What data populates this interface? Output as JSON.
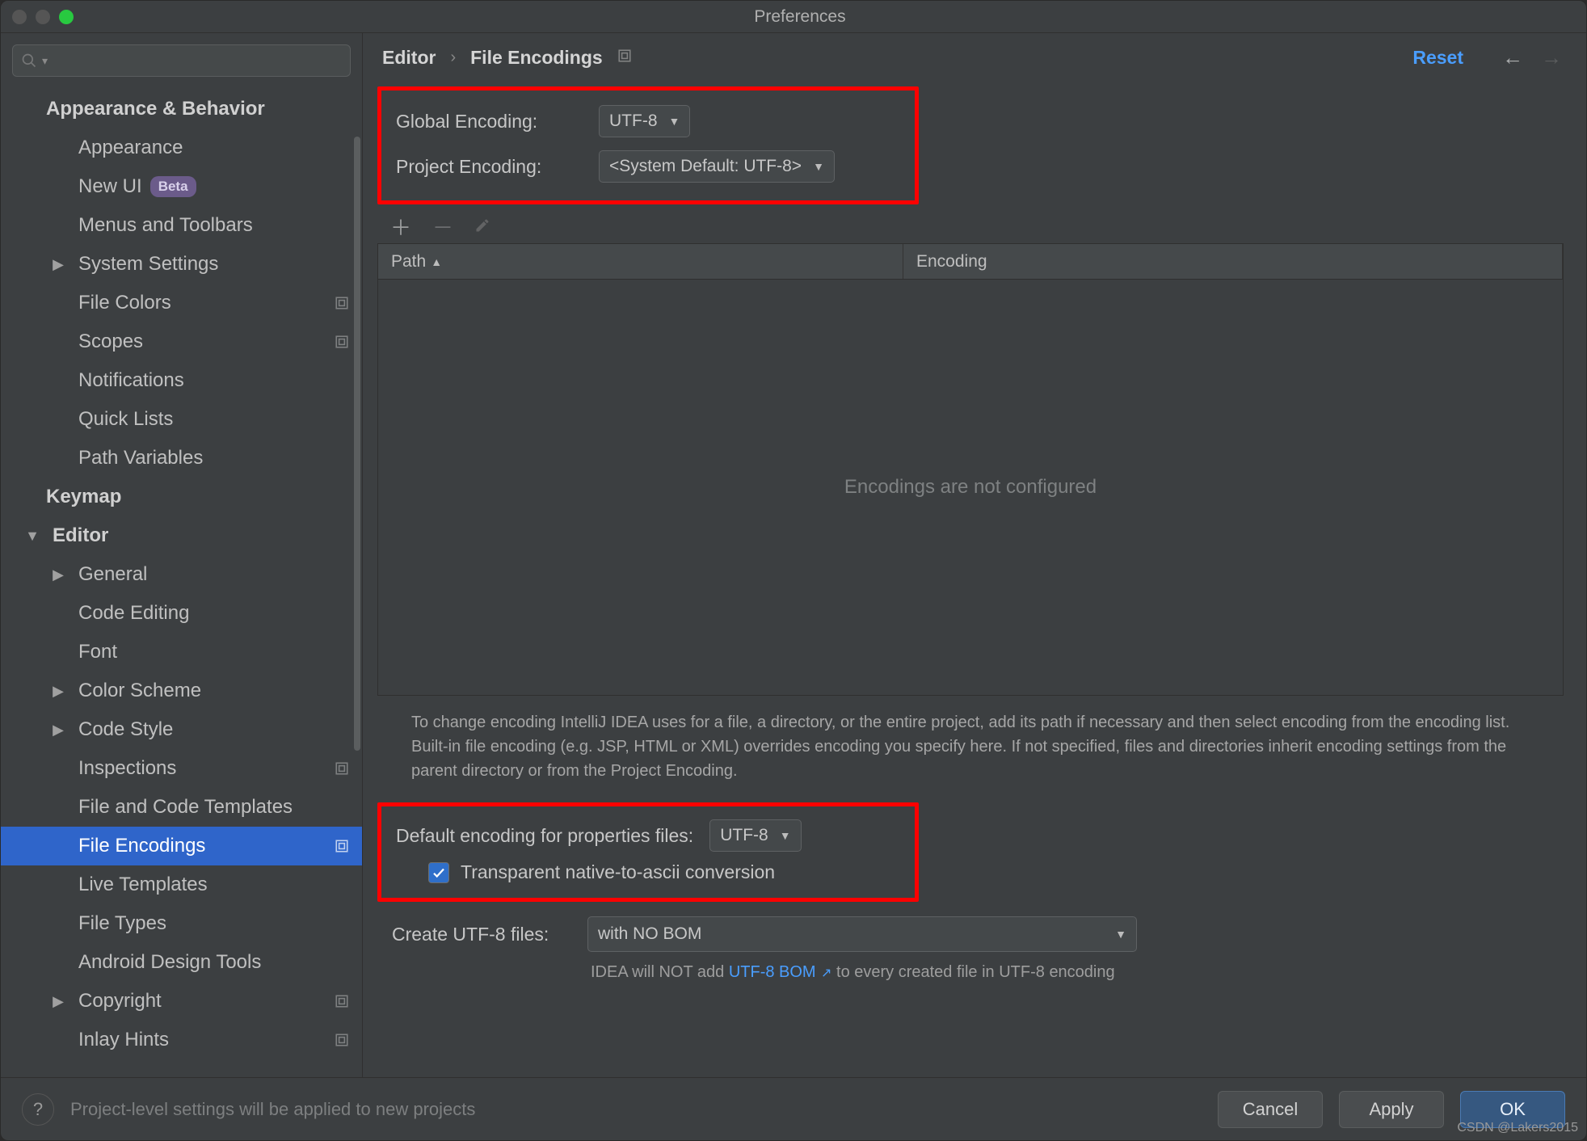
{
  "window": {
    "title": "Preferences"
  },
  "sidebar": {
    "search_placeholder": "",
    "items": [
      {
        "label": "Appearance & Behavior",
        "level": 0,
        "expandable": true,
        "expanded": true
      },
      {
        "label": "Appearance",
        "level": 1
      },
      {
        "label": "New UI",
        "level": 1,
        "badge": "Beta"
      },
      {
        "label": "Menus and Toolbars",
        "level": 1
      },
      {
        "label": "System Settings",
        "level": 1,
        "chev": "right"
      },
      {
        "label": "File Colors",
        "level": 1,
        "proj": true
      },
      {
        "label": "Scopes",
        "level": 1,
        "proj": true
      },
      {
        "label": "Notifications",
        "level": 1
      },
      {
        "label": "Quick Lists",
        "level": 1
      },
      {
        "label": "Path Variables",
        "level": 1
      },
      {
        "label": "Keymap",
        "level": 0
      },
      {
        "label": "Editor",
        "level": 0,
        "chev": "down"
      },
      {
        "label": "General",
        "level": 1,
        "chev": "right"
      },
      {
        "label": "Code Editing",
        "level": 1
      },
      {
        "label": "Font",
        "level": 1
      },
      {
        "label": "Color Scheme",
        "level": 1,
        "chev": "right"
      },
      {
        "label": "Code Style",
        "level": 1,
        "chev": "right"
      },
      {
        "label": "Inspections",
        "level": 1,
        "proj": true
      },
      {
        "label": "File and Code Templates",
        "level": 1
      },
      {
        "label": "File Encodings",
        "level": 1,
        "selected": true,
        "proj": true,
        "proj_white": true
      },
      {
        "label": "Live Templates",
        "level": 1
      },
      {
        "label": "File Types",
        "level": 1
      },
      {
        "label": "Android Design Tools",
        "level": 1
      },
      {
        "label": "Copyright",
        "level": 1,
        "chev": "right",
        "proj": true
      },
      {
        "label": "Inlay Hints",
        "level": 1,
        "proj": true
      }
    ]
  },
  "breadcrumb": {
    "root": "Editor",
    "leaf": "File Encodings",
    "reset": "Reset"
  },
  "settings": {
    "global_label": "Global Encoding:",
    "global_value": "UTF-8",
    "project_label": "Project Encoding:",
    "project_value": "<System Default: UTF-8>",
    "table": {
      "col_path": "Path",
      "col_encoding": "Encoding",
      "empty": "Encodings are not configured"
    },
    "help": "To change encoding IntelliJ IDEA uses for a file, a directory, or the entire project, add its path if necessary and then select encoding from the encoding list. Built-in file encoding (e.g. JSP, HTML or XML) overrides encoding you specify here. If not specified, files and directories inherit encoding settings from the parent directory or from the Project Encoding.",
    "props_label": "Default encoding for properties files:",
    "props_value": "UTF-8",
    "checkbox": "Transparent native-to-ascii conversion",
    "bom_label": "Create UTF-8 files:",
    "bom_value": "with NO BOM",
    "bom_help_pre": "IDEA will NOT add ",
    "bom_link": "UTF-8 BOM",
    "bom_help_post": " to every created file in UTF-8 encoding"
  },
  "footer": {
    "note": "Project-level settings will be applied to new projects",
    "cancel": "Cancel",
    "apply": "Apply",
    "ok": "OK"
  },
  "watermark": "CSDN @Lakers2015"
}
